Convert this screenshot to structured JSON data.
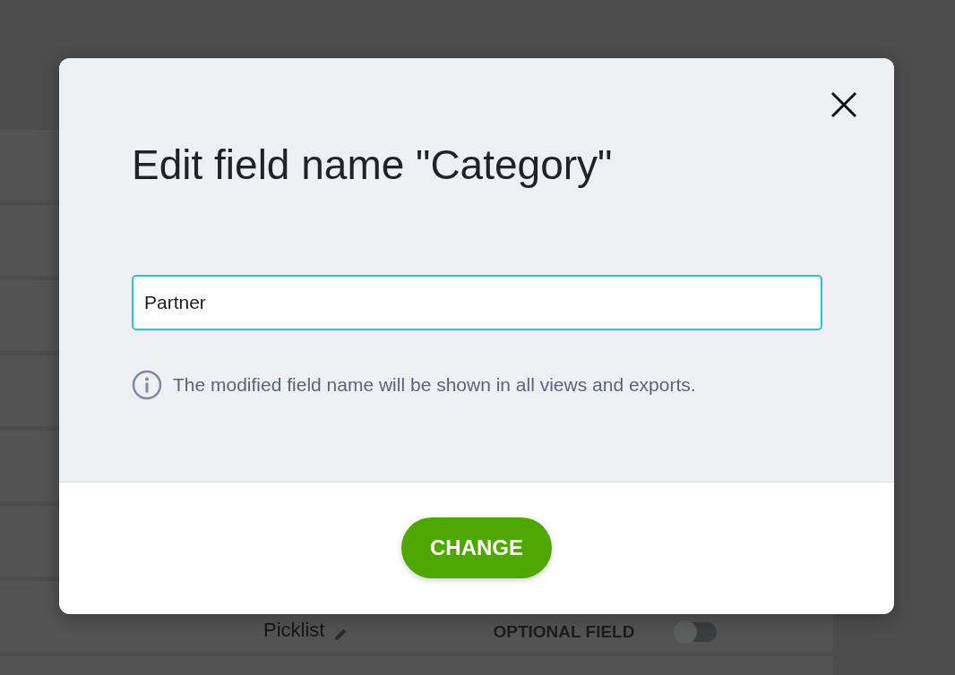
{
  "background": {
    "rows": [
      {
        "field_type": "Picklist",
        "label": "OPTIONAL FIELD",
        "on": false
      }
    ]
  },
  "dialog": {
    "title": "Edit field name \"Category\"",
    "field": {
      "value": "Partner",
      "focused": true
    },
    "hint": "The modified field name will be shown in all views and exports.",
    "button": "CHANGE"
  }
}
